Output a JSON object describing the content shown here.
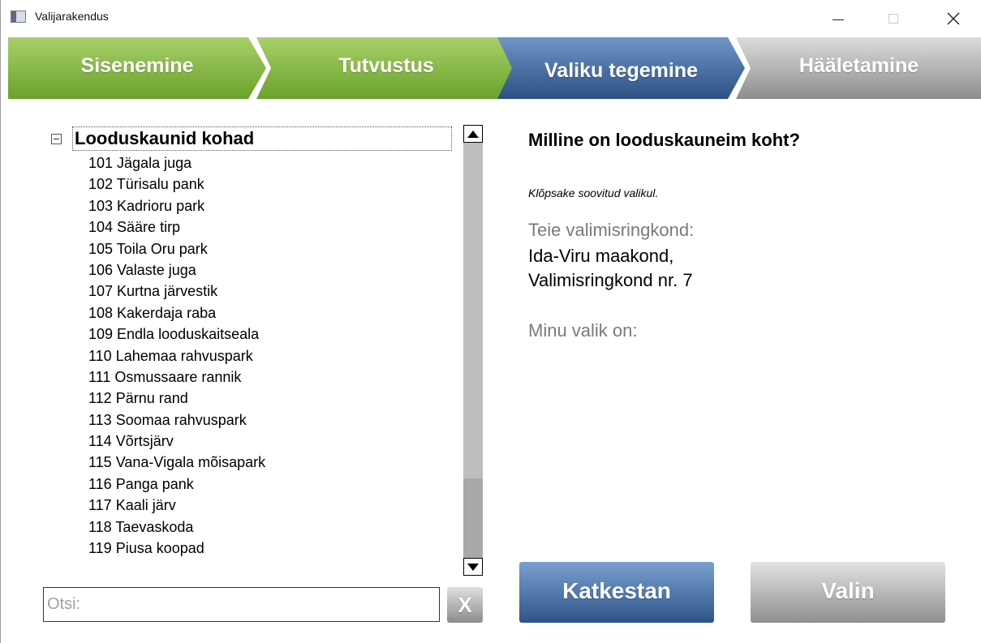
{
  "window": {
    "title": "Valijarakendus",
    "icon": "app-window-icon"
  },
  "steps": [
    {
      "label": "Sisenemine",
      "state": "done",
      "color": "#7fb33d"
    },
    {
      "label": "Tutvustus",
      "state": "done",
      "color": "#7fb33d"
    },
    {
      "label": "Valiku tegemine",
      "state": "current",
      "color": "#3d64a0"
    },
    {
      "label": "Hääletamine",
      "state": "pending",
      "color": "#a6a6a6"
    }
  ],
  "tree": {
    "title": "Looduskaunid kohad",
    "expanded": true,
    "items": [
      "101 Jägala juga",
      "102 Türisalu pank",
      "103 Kadrioru park",
      "104 Sääre tirp",
      "105 Toila Oru park",
      "106 Valaste juga",
      "107 Kurtna järvestik",
      "108 Kakerdaja raba",
      "109 Endla looduskaitseala",
      "110 Lahemaa rahvuspark",
      "111 Osmussaare rannik",
      "112 Pärnu rand",
      "113 Soomaa rahvuspark",
      "114 Võrtsjärv",
      "115 Vana-Vigala mõisapark",
      "116 Panga pank",
      "117 Kaali järv",
      "118 Taevaskoda",
      "119 Piusa koopad"
    ]
  },
  "search": {
    "placeholder": "Otsi:",
    "value": "",
    "clear_label": "X"
  },
  "panel": {
    "question": "Milline on looduskauneim koht?",
    "instruction": "Klõpsake soovitud valikul.",
    "district_label": "Teie valimisringkond:",
    "district_line1": "Ida-Viru maakond,",
    "district_line2": "Valimisringkond nr. 7",
    "choice_label": "Minu valik on:"
  },
  "buttons": {
    "cancel": "Katkestan",
    "choose": "Valin"
  },
  "colors": {
    "accent_blue": "#3d64a0",
    "accent_green": "#7fb33d",
    "disabled_gray": "#a6a6a6"
  }
}
